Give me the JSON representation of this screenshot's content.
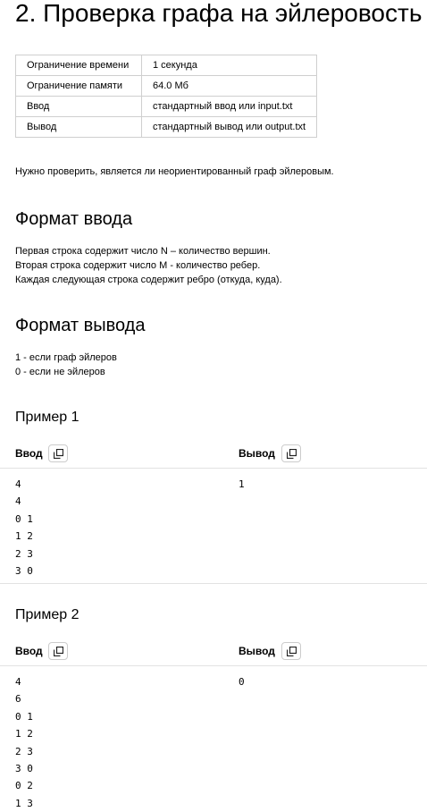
{
  "title": "2. Проверка графа на эйлеровость",
  "limits": [
    {
      "key": "Ограничение времени",
      "value": "1 секунда"
    },
    {
      "key": "Ограничение памяти",
      "value": "64.0 Мб"
    },
    {
      "key": "Ввод",
      "value": "стандартный ввод или input.txt"
    },
    {
      "key": "Вывод",
      "value": "стандартный вывод или output.txt"
    }
  ],
  "statement": "Нужно проверить, является ли неориентированный граф эйлеровым.",
  "input_format": {
    "heading": "Формат ввода",
    "lines": [
      "Первая строка содержит число N – количество вершин.",
      "Вторая строка содержит число M - количество ребер.",
      "Каждая следующая строка содержит ребро (откуда, куда)."
    ]
  },
  "output_format": {
    "heading": "Формат вывода",
    "lines": [
      "1 - если граф эйлеров",
      "0 - если не эйлеров"
    ]
  },
  "examples": [
    {
      "heading": "Пример 1",
      "input_label": "Ввод",
      "output_label": "Вывод",
      "input": "4\n4\n0 1\n1 2\n2 3\n3 0",
      "output": "1"
    },
    {
      "heading": "Пример 2",
      "input_label": "Ввод",
      "output_label": "Вывод",
      "input": "4\n6\n0 1\n1 2\n2 3\n3 0\n0 2\n1 3",
      "output": "0"
    }
  ],
  "icons": {
    "copy": "copy-icon"
  }
}
